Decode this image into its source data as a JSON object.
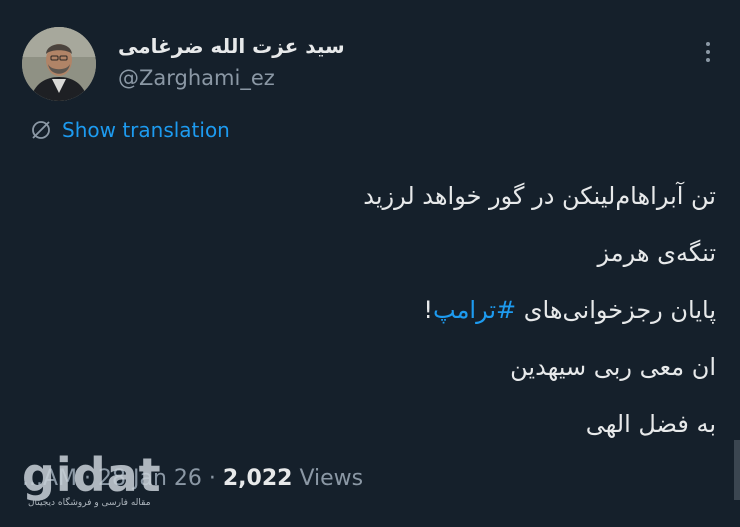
{
  "author": {
    "display_name": "سید عزت الله ضرغامی",
    "handle": "@Zarghami_ez"
  },
  "translate": {
    "label": "Show translation",
    "icon": "globe-icon"
  },
  "tweet": {
    "lines": [
      "تن آبراهام‌لینکن در گور خواهد لرزید",
      "تنگه‌ی هرمز",
      "ان معی ربی سیهدین",
      "به فضل الهی"
    ],
    "line3_text": "پایان رجزخوانی‌های ",
    "hashtag": "#ترامپ",
    "line3_end": "!"
  },
  "meta": {
    "time_prefix": "...AM · ",
    "date": "28 Jan 26",
    "separator": " · ",
    "views_count": "2,022",
    "views_label": " Views"
  },
  "watermark": {
    "brand": "gidat",
    "tagline": "مقاله فارسی و فروشگاه دیجیتال"
  },
  "colors": {
    "background": "#15202b",
    "text": "#e7e9ea",
    "secondary": "#8b98a5",
    "accent": "#1d9bf0"
  }
}
